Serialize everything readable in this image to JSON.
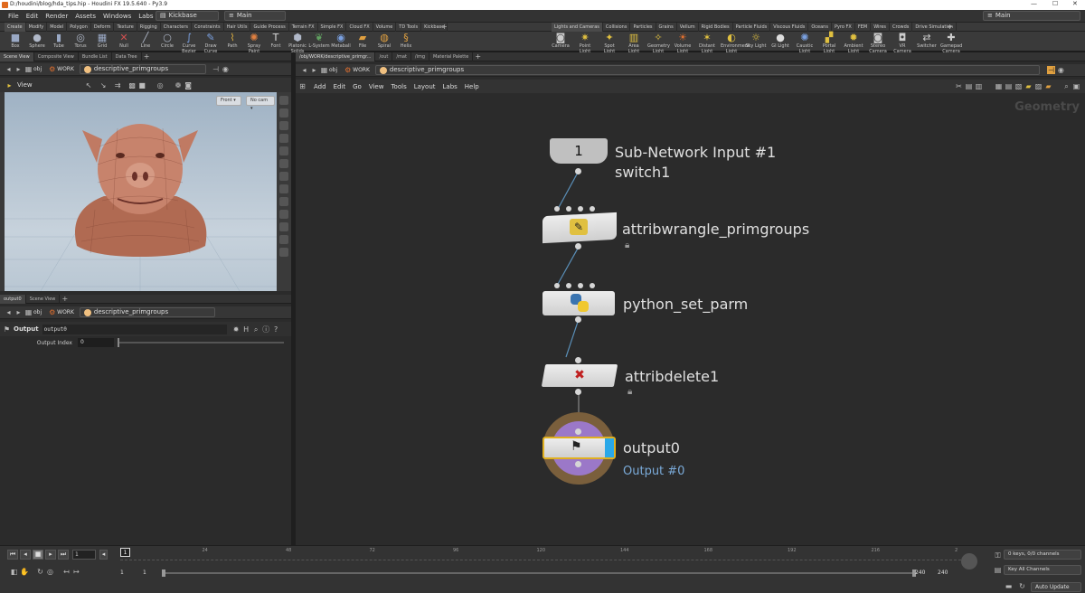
{
  "window": {
    "title": "D:/houdini/blog/hda_tips.hip - Houdini FX 19.5.640 - Py3.9",
    "controls": [
      "—",
      "☐",
      "✕"
    ]
  },
  "menubar": {
    "items": [
      "File",
      "Edit",
      "Render",
      "Assets",
      "Windows",
      "Labs",
      "Help"
    ],
    "desktop": "Kickbase",
    "desktop_glyph": "▤",
    "main": "Main",
    "main_glyph": "≡",
    "right_main": "Main"
  },
  "shelf_tabs_left": [
    "Create",
    "Modify",
    "Model",
    "Polygon",
    "Deform",
    "Texture",
    "Rigging",
    "Characters",
    "Constraints",
    "Hair Utils",
    "Guide Process",
    "Terrain FX",
    "Simple FX",
    "Cloud FX",
    "Volume",
    "TD Tools",
    "Kickbase"
  ],
  "shelf_tabs_right": [
    "Lights and Cameras",
    "Collisions",
    "Particles",
    "Grains",
    "Vellum",
    "Rigid Bodies",
    "Particle Fluids",
    "Viscous Fluids",
    "Oceans",
    "Pyro FX",
    "FEM",
    "Wires",
    "Crowds",
    "Drive Simulation"
  ],
  "tools_left": [
    {
      "label": "Box",
      "icon": "box-icon",
      "glyph": "■",
      "color": "#9aa9c5"
    },
    {
      "label": "Sphere",
      "icon": "sphere-icon",
      "glyph": "●",
      "color": "#b0b8c8"
    },
    {
      "label": "Tube",
      "icon": "tube-icon",
      "glyph": "▮",
      "color": "#9aa9c5"
    },
    {
      "label": "Torus",
      "icon": "torus-icon",
      "glyph": "◎",
      "color": "#b0b8c8"
    },
    {
      "label": "Grid",
      "icon": "grid-icon",
      "glyph": "▦",
      "color": "#9aa9c5"
    },
    {
      "label": "Null",
      "icon": "null-icon",
      "glyph": "✕",
      "color": "#d05050"
    },
    {
      "label": "Line",
      "icon": "line-icon",
      "glyph": "╱",
      "color": "#b0b8c8"
    },
    {
      "label": "Circle",
      "icon": "circle-icon",
      "glyph": "○",
      "color": "#b0b8c8"
    },
    {
      "label": "Curve Bezier",
      "icon": "curve-bezier-icon",
      "glyph": "∫",
      "color": "#7aa0e0"
    },
    {
      "label": "Draw Curve",
      "icon": "draw-curve-icon",
      "glyph": "✎",
      "color": "#7aa0e0"
    },
    {
      "label": "Path",
      "icon": "path-icon",
      "glyph": "⌇",
      "color": "#e0b040"
    },
    {
      "label": "Spray Paint",
      "icon": "spray-paint-icon",
      "glyph": "✺",
      "color": "#e08040"
    },
    {
      "label": "Font",
      "icon": "font-icon",
      "glyph": "T",
      "color": "#dddddd"
    },
    {
      "label": "Platonic Solids",
      "icon": "platonic-solids-icon",
      "glyph": "⬢",
      "color": "#b0b8c8"
    },
    {
      "label": "L-System",
      "icon": "l-system-icon",
      "glyph": "❦",
      "color": "#60a060"
    },
    {
      "label": "Metaball",
      "icon": "metaball-icon",
      "glyph": "◉",
      "color": "#7aa0e0"
    },
    {
      "label": "File",
      "icon": "file-icon",
      "glyph": "▰",
      "color": "#e0a040"
    },
    {
      "label": "Spiral",
      "icon": "spiral-icon",
      "glyph": "◍",
      "color": "#e0a040"
    },
    {
      "label": "Helix",
      "icon": "helix-icon",
      "glyph": "§",
      "color": "#e0a040"
    }
  ],
  "tools_right": [
    {
      "label": "Camera",
      "icon": "camera-icon",
      "glyph": "◙",
      "color": "#cccccc"
    },
    {
      "label": "Point Light",
      "icon": "point-light-icon",
      "glyph": "✷",
      "color": "#e0c040"
    },
    {
      "label": "Spot Light",
      "icon": "spot-light-icon",
      "glyph": "✦",
      "color": "#e0c040"
    },
    {
      "label": "Area Light",
      "icon": "area-light-icon",
      "glyph": "▥",
      "color": "#e0c040"
    },
    {
      "label": "Geometry Light",
      "icon": "geometry-light-icon",
      "glyph": "✧",
      "color": "#e0c040"
    },
    {
      "label": "Volume Light",
      "icon": "volume-light-icon",
      "glyph": "☀",
      "color": "#e07030"
    },
    {
      "label": "Distant Light",
      "icon": "distant-light-icon",
      "glyph": "✶",
      "color": "#e0c040"
    },
    {
      "label": "Environment Light",
      "icon": "environment-light-icon",
      "glyph": "◐",
      "color": "#e0c040"
    },
    {
      "label": "Sky Light",
      "icon": "sky-light-icon",
      "glyph": "☼",
      "color": "#e0c040"
    },
    {
      "label": "GI Light",
      "icon": "gi-light-icon",
      "glyph": "●",
      "color": "#dddddd"
    },
    {
      "label": "Caustic Light",
      "icon": "caustic-light-icon",
      "glyph": "✺",
      "color": "#7aa0e0"
    },
    {
      "label": "Portal Light",
      "icon": "portal-light-icon",
      "glyph": "▞",
      "color": "#e0c040"
    },
    {
      "label": "Ambient Light",
      "icon": "ambient-light-icon",
      "glyph": "✹",
      "color": "#e0c040"
    },
    {
      "label": "Stereo Camera",
      "icon": "stereo-camera-icon",
      "glyph": "◙",
      "color": "#cccccc"
    },
    {
      "label": "VR Camera",
      "icon": "vr-camera-icon",
      "glyph": "◘",
      "color": "#cccccc"
    },
    {
      "label": "Switcher",
      "icon": "switcher-icon",
      "glyph": "⇄",
      "color": "#cccccc"
    },
    {
      "label": "Gamepad Camera",
      "icon": "gamepad-camera-icon",
      "glyph": "✚",
      "color": "#cccccc"
    }
  ],
  "left_top": {
    "tabs": [
      "Scene View",
      "Composite View",
      "Bundle List",
      "Data Tree"
    ],
    "path": {
      "obj": "obj",
      "work": "WORK",
      "node": "descriptive_primgroups"
    },
    "view_label": "View",
    "front": "Front ▾",
    "nocam": "No cam ▾"
  },
  "left_bottom": {
    "tabs": [
      "output0",
      "Scene View"
    ],
    "path": {
      "obj": "obj",
      "work": "WORK",
      "node": "descriptive_primgroups"
    },
    "node_type": "Output",
    "node_name": "output0",
    "param_label": "Output Index",
    "param_value": "0"
  },
  "right_tabs": [
    "/obj/WORK/descriptive_primgr...",
    "/out",
    "/mat",
    "/img",
    "Material Palette"
  ],
  "net_path": {
    "obj": "obj",
    "work": "WORK",
    "node": "descriptive_primgroups"
  },
  "net_menu": [
    "Add",
    "Edit",
    "Go",
    "View",
    "Tools",
    "Layout",
    "Labs",
    "Help"
  ],
  "net_context": "Geometry",
  "nodes": {
    "subnet_input": {
      "number": "1",
      "label": "Sub-Network Input #1",
      "sublabel": "switch1"
    },
    "wrangle": {
      "label": "attribwrangle_primgroups"
    },
    "python": {
      "label": "python_set_parm"
    },
    "attribdelete": {
      "label": "attribdelete1"
    },
    "output": {
      "label": "output0",
      "sublabel": "Output #0"
    }
  },
  "timeline": {
    "ticks": [
      "1",
      "24",
      "48",
      "72",
      "96",
      "120",
      "144",
      "168",
      "192",
      "216",
      "2"
    ],
    "current_frame": "1",
    "start": "1",
    "start2": "1",
    "end": "240",
    "end2": "240",
    "keys_status": "0 keys, 0/0 channels",
    "key_all": "Key All Channels",
    "auto_update": "Auto Update"
  }
}
